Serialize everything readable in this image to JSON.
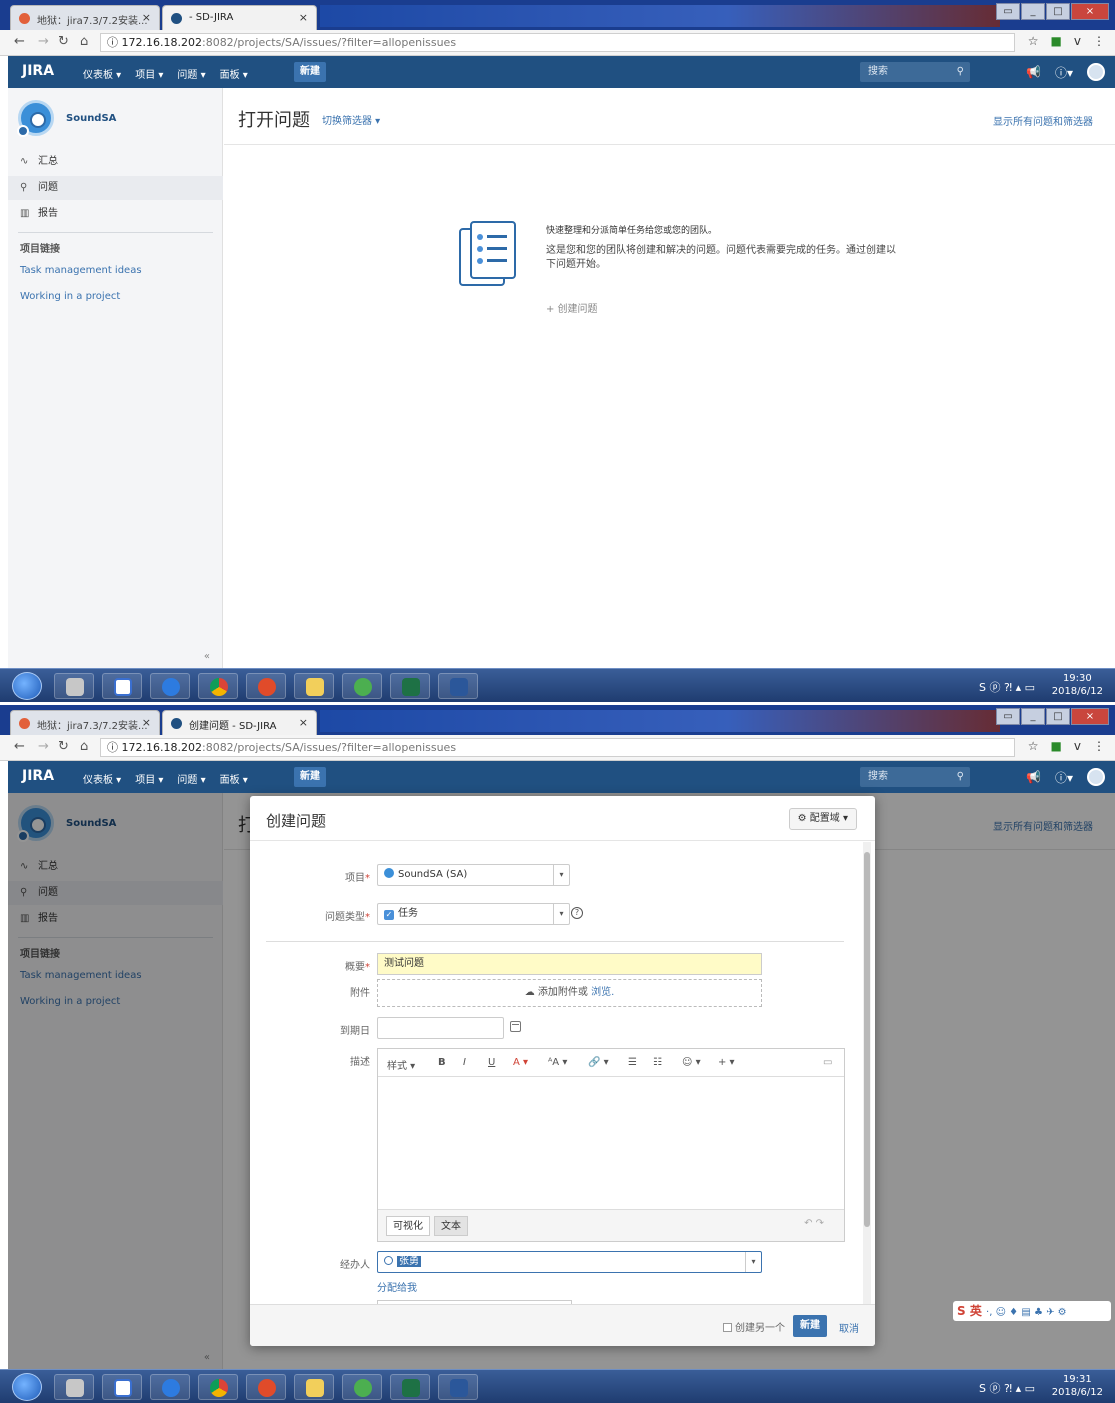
{
  "shot1": {
    "tabs": [
      {
        "label": "地狱：jira7.3/7.2安装..."
      },
      {
        "label": "- SD-JIRA"
      }
    ],
    "url_host": "172.16.18.202",
    "url_rest": ":8082/projects/SA/issues/?filter=allopenissues",
    "header": {
      "logo": "JIRA",
      "nav": [
        "仪表板 ▾",
        "项目 ▾",
        "问题 ▾",
        "面板 ▾"
      ],
      "create": "新建",
      "search_placeholder": "搜索"
    },
    "sidebar": {
      "project_name": "SoundSA",
      "items": [
        {
          "icon": "∿",
          "label": "汇总"
        },
        {
          "icon": "⚲",
          "label": "问题"
        },
        {
          "icon": "▥",
          "label": "报告"
        }
      ],
      "section_label": "项目链接",
      "links": [
        "Task management ideas",
        "Working in a project"
      ],
      "collapse": "«"
    },
    "main": {
      "title": "打开问题",
      "switch_filter": "切换筛选器 ▾",
      "show_all": "显示所有问题和筛选器",
      "empty_heading": "快速整理和分派简单任务给您或您的团队。",
      "empty_text": "这是您和您的团队将创建和解决的问题。问题代表需要完成的任务。通过创建以下问题开始。",
      "create_link": "+ 创建问题"
    },
    "clock_time": "19:30",
    "clock_date": "2018/6/12"
  },
  "shot2": {
    "tabs": [
      {
        "label": "地狱：jira7.3/7.2安装..."
      },
      {
        "label": "创建问题 - SD-JIRA"
      }
    ],
    "url_host": "172.16.18.202",
    "url_rest": ":8082/projects/SA/issues/?filter=allopenissues",
    "dialog": {
      "title": "创建问题",
      "configure": "⚙ 配置域 ▾",
      "labels": {
        "project": "项目",
        "issue_type": "问题类型",
        "summary": "概要",
        "attachment": "附件",
        "due_date": "到期日",
        "description": "描述",
        "assignee": "经办人"
      },
      "project_value": "SoundSA (SA)",
      "issue_type_value": "任务",
      "summary_value": "测试问题",
      "attach_text": "添加附件或",
      "attach_link": "浏览.",
      "toolbar": [
        "样式 ▾",
        "B",
        "I",
        "U",
        "A ▾",
        "ᴬA ▾",
        "🔗 ▾",
        "☰",
        "☷",
        "☺ ▾",
        "+ ▾",
        "▭"
      ],
      "mode_visual": "可视化",
      "mode_text": "文本",
      "undo": "↶ ↷",
      "assignee_value": "张勇",
      "assign_me": "分配给我",
      "create_another": "创建另一个",
      "create_button": "新建",
      "cancel": "取消"
    },
    "ime": "英",
    "clock_time": "19:31",
    "clock_date": "2018/6/12"
  },
  "colors": {
    "jira_header": "#205081",
    "link_blue": "#3b73af",
    "summary_bg": "#fffbc7"
  }
}
